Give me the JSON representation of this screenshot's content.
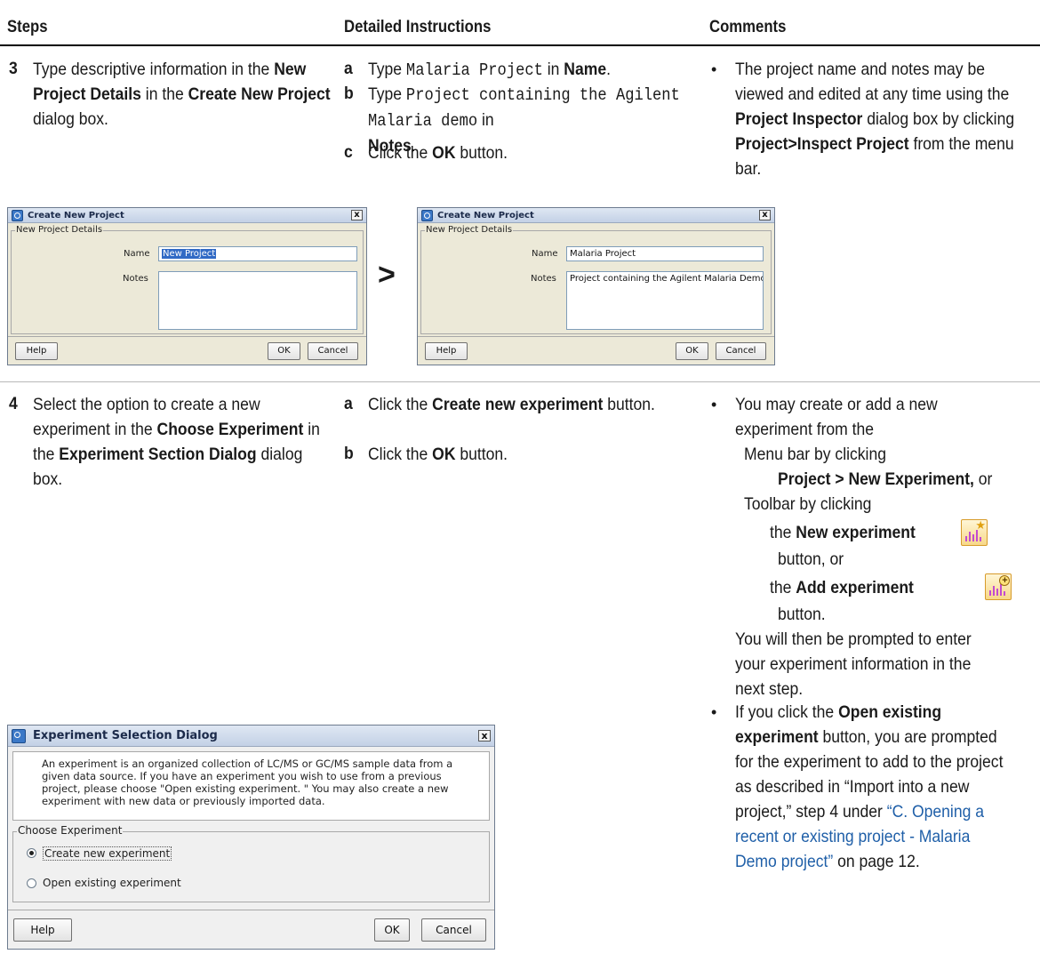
{
  "headers": {
    "steps": "Steps",
    "detailed": "Detailed Instructions",
    "comments": "Comments"
  },
  "step3": {
    "num": "3",
    "text_parts": [
      "Type descriptive information in the ",
      "New Project Details",
      " in the ",
      "Create New Project",
      " dialog box."
    ],
    "a_letter": "a",
    "a_type": "Type ",
    "a_code": "Malaria Project",
    "a_in": " in ",
    "a_name": "Name",
    "a_dot": ".",
    "b_letter": "b",
    "b_type": "Type ",
    "b_code": "Project containing the Agilent Malaria demo",
    "b_in": " in ",
    "b_notes": "Notes",
    "b_dot": ".",
    "c_letter": "c",
    "c_pre": "Click the ",
    "c_ok": "OK",
    "c_post": " button.",
    "comment_parts": [
      "The project name and notes may be viewed and edited at any time using the ",
      "Project Inspector",
      " dialog box by clicking ",
      "Project>Inspect Project",
      " from the menu bar."
    ]
  },
  "dialog_before": {
    "title": "Create New Project",
    "group": "New Project Details",
    "name_label": "Name",
    "name_value": "New Project",
    "notes_label": "Notes",
    "notes_value": "",
    "help": "Help",
    "ok": "OK",
    "cancel": "Cancel",
    "close": "x"
  },
  "arrow": ">",
  "dialog_after": {
    "title": "Create New Project",
    "group": "New Project Details",
    "name_label": "Name",
    "name_value": "Malaria Project",
    "notes_label": "Notes",
    "notes_value": "Project containing the Agilent Malaria Demo",
    "help": "Help",
    "ok": "OK",
    "cancel": "Cancel",
    "close": "x"
  },
  "step4": {
    "num": "4",
    "text_parts": [
      "Select the option to create a new experiment in the ",
      "Choose Experiment",
      " in the ",
      "Experiment Section Dialog",
      " dialog box."
    ],
    "a_letter": "a",
    "a_pre": "Click the ",
    "a_bold": "Create new experiment",
    "a_post": " button.",
    "b_letter": "b",
    "b_pre": "Click the ",
    "b_ok": "OK",
    "b_post": " button.",
    "c1_intro": "You may create or add a new experiment from the",
    "c1_menu": "Menu bar by clicking",
    "c1_menu_cmd": "Project > New Experiment,",
    "c1_or": " or",
    "c1_toolbar": "Toolbar by clicking",
    "c1_the1": "the ",
    "c1_new_exp": "New experiment",
    "c1_btn_or": "button, or",
    "c1_the2": "the ",
    "c1_add_exp": "Add experiment",
    "c1_btn": "button.",
    "c1_then": "You will then be prompted to enter your experiment information in the next step.",
    "c2_pre": "If you click the ",
    "c2_bold": "Open existing experiment",
    "c2_mid": " button, you are prompted for the experiment to add to the project as described in “Import into a new project,” step 4 under ",
    "c2_link": "“C. Opening a recent or existing project - Malaria Demo project”",
    "c2_post": " on page 12."
  },
  "exp_dialog": {
    "title": "Experiment Selection Dialog",
    "desc": "An experiment is an organized collection of LC/MS or GC/MS sample data from a given data source. If you have an experiment you wish to use from a previous project, please choose \"Open existing experiment. \" You may also create a new experiment with new data or previously imported data.",
    "group": "Choose Experiment",
    "opt1": "Create new experiment",
    "opt2": "Open existing experiment",
    "selected": "Create new experiment",
    "help": "Help",
    "ok": "OK",
    "cancel": "Cancel",
    "close": "x"
  },
  "icons": {
    "new_experiment": "new-experiment-icon",
    "add_experiment": "add-experiment-icon"
  }
}
